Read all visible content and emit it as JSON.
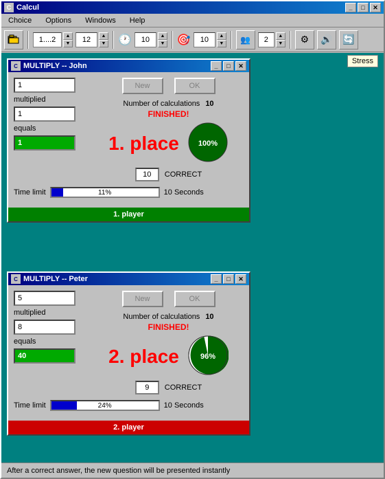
{
  "main_window": {
    "title": "Calcul",
    "menu": {
      "items": [
        "Choice",
        "Options",
        "Windows",
        "Help"
      ]
    },
    "toolbar": {
      "spinner1_value": "1....2",
      "spinner2_value": "12",
      "spinner3_value": "10",
      "spinner4_value": "10",
      "spinner5_value": "2"
    },
    "stress_tooltip": "Stress",
    "status_bar_text": "After a correct answer, the new question will be presented instantly"
  },
  "player1": {
    "title": "MULTIPLY  --  John",
    "input1": "1",
    "label1": "multiplied",
    "input2": "1",
    "label2": "equals",
    "result": "1",
    "btn_new": "New",
    "btn_ok": "OK",
    "num_calcs_label": "Number of calculations",
    "num_calcs_value": "10",
    "finished_text": "FINISHED!",
    "place_text": "1. place",
    "pie_percent": 100,
    "correct_value": "10",
    "correct_label": "CORRECT",
    "time_limit_label": "Time limit",
    "time_percent": 11,
    "time_percent_text": "11%",
    "time_seconds": "10 Seconds",
    "player_bar": "1. player"
  },
  "player2": {
    "title": "MULTIPLY  --  Peter",
    "input1": "5",
    "label1": "multiplied",
    "input2": "8",
    "label2": "equals",
    "result": "40",
    "btn_new": "New",
    "btn_ok": "OK",
    "num_calcs_label": "Number of calculations",
    "num_calcs_value": "10",
    "finished_text": "FINISHED!",
    "place_text": "2. place",
    "pie_percent": 96,
    "correct_value": "9",
    "correct_label": "CORRECT",
    "time_limit_label": "Time limit",
    "time_percent": 24,
    "time_percent_text": "24%",
    "time_seconds": "10 Seconds",
    "player_bar": "2. player"
  }
}
